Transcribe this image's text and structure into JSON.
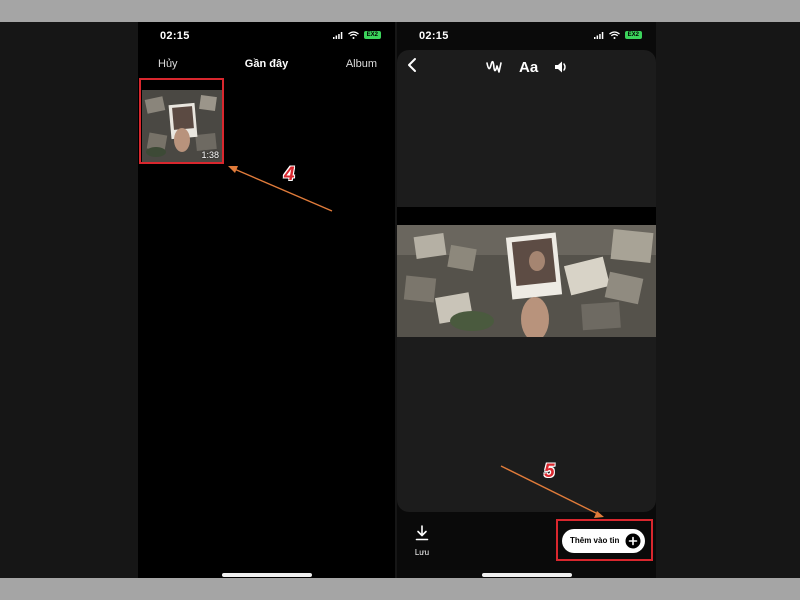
{
  "status_bar": {
    "time": "02:15",
    "battery_label": "EX2"
  },
  "picker": {
    "cancel_label": "Hủy",
    "title": "Gần đây",
    "album_label": "Album",
    "thumbnail": {
      "duration": "1:38"
    }
  },
  "editor": {
    "text_tool_label": "Aa",
    "save_label": "Lưu",
    "add_to_story_label": "Thêm vào tin"
  },
  "annotations": {
    "step_4": "4",
    "step_5": "5",
    "highlight_color": "#d9272e",
    "arrow_color": "#e07b3a"
  },
  "colors": {
    "battery_green": "#3bd35b",
    "background": "#000000",
    "card": "#1c1c1c"
  },
  "icons": {
    "back": "chevron-left-icon",
    "draw": "squiggle-draw-icon",
    "sound": "speaker-icon",
    "save": "download-icon",
    "add": "plus-circle-icon"
  }
}
